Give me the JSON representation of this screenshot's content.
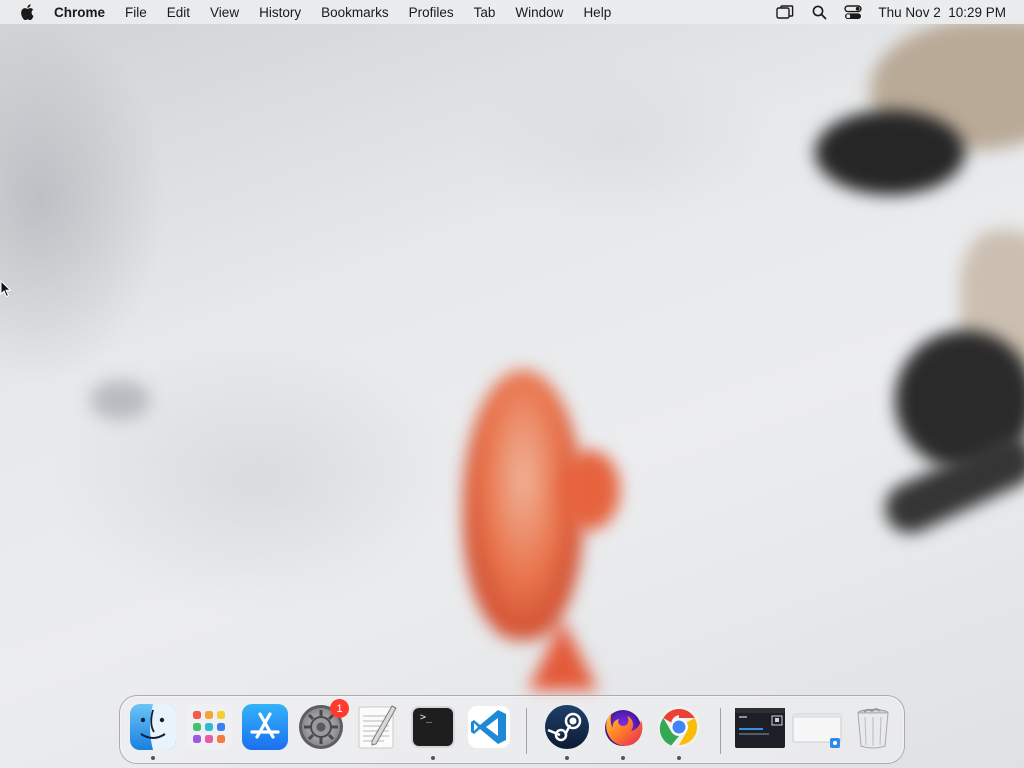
{
  "menubar": {
    "app_name": "Chrome",
    "items": [
      "File",
      "Edit",
      "View",
      "History",
      "Bookmarks",
      "Profiles",
      "Tab",
      "Window",
      "Help"
    ],
    "clock": "Thu Nov 2  10:29 PM"
  },
  "dock": {
    "apps": [
      {
        "name": "Finder",
        "icon": "finder-icon",
        "running": true
      },
      {
        "name": "Launchpad",
        "icon": "launchpad-icon",
        "running": false
      },
      {
        "name": "App Store",
        "icon": "app-store-icon",
        "running": false
      },
      {
        "name": "System Settings",
        "icon": "settings-gear-icon",
        "running": false,
        "badge": "1"
      },
      {
        "name": "TextEdit",
        "icon": "textedit-icon",
        "running": false
      },
      {
        "name": "Terminal",
        "icon": "terminal-icon",
        "running": true
      },
      {
        "name": "Visual Studio Code",
        "icon": "vscode-icon",
        "running": false
      },
      {
        "name": "Steam",
        "icon": "steam-icon",
        "running": true
      },
      {
        "name": "Firefox",
        "icon": "firefox-icon",
        "running": true
      },
      {
        "name": "Google Chrome",
        "icon": "chrome-icon",
        "running": true
      }
    ],
    "terminal_prompt": ">_"
  },
  "colors": {
    "badge": "#ff3b30",
    "vscode_blue": "#1e8ad6",
    "app_store_blue": "#1c8bf5"
  }
}
